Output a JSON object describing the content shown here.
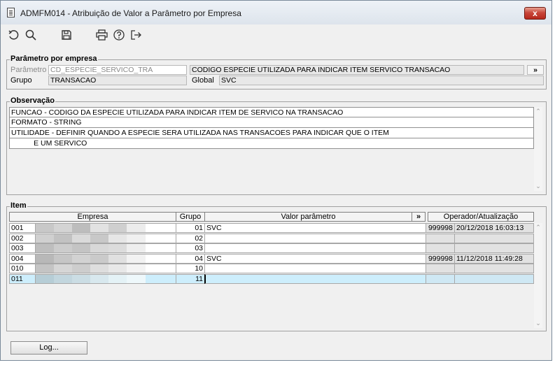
{
  "window": {
    "title": "ADMFM014 - Atribuição de Valor a Parâmetro por Empresa",
    "close_symbol": "x"
  },
  "toolbar": {
    "icons": [
      "undo-icon",
      "search-icon",
      "save-icon",
      "print-icon",
      "help-icon",
      "exit-icon"
    ]
  },
  "param": {
    "section_title": "Parâmetro por empresa",
    "parametro_label": "Parâmetro",
    "parametro_value": "CD_ESPECIE_SERVICO_TRA",
    "descricao_value": "CODIGO ESPECIE UTILIZADA PARA INDICAR ITEM SERVICO TRANSACAO",
    "more_button": "»",
    "grupo_label": "Grupo",
    "grupo_value": "TRANSACAO",
    "global_label": "Global",
    "global_value": "SVC"
  },
  "obs": {
    "section_title": "Observação",
    "lines": [
      "FUNCAO - CODIGO DA ESPECIE UTILIZADA PARA INDICAR ITEM DE SERVICO NA TRANSACAO",
      "FORMATO - STRING",
      "UTILIDADE - DEFINIR QUANDO A ESPECIE SERA UTILIZADA NAS TRANSACOES PARA INDICAR QUE O ITEM",
      "           E UM SERVICO"
    ]
  },
  "item": {
    "section_title": "Item",
    "headers": {
      "empresa": "Empresa",
      "grupo": "Grupo",
      "valor": "Valor parâmetro",
      "more": "»",
      "operador": "Operador/Atualização"
    },
    "rows": [
      {
        "code": "001",
        "grupo": "01",
        "valor": "SVC",
        "operador": "999998",
        "data": "20/12/2018 16:03:13"
      },
      {
        "code": "002",
        "grupo": "02",
        "valor": "",
        "operador": "",
        "data": ""
      },
      {
        "code": "003",
        "grupo": "03",
        "valor": "",
        "operador": "",
        "data": ""
      },
      {
        "code": "004",
        "grupo": "04",
        "valor": "SVC",
        "operador": "999998",
        "data": "11/12/2018 11:49:28"
      },
      {
        "code": "010",
        "grupo": "10",
        "valor": "",
        "operador": "",
        "data": ""
      },
      {
        "code": "011",
        "grupo": "11",
        "valor": "",
        "operador": "",
        "data": ""
      }
    ]
  },
  "footer": {
    "log_button": "Log..."
  },
  "colors": {
    "selected_row": "#cdeefc",
    "readonly_field": "#e8e8e8",
    "close_button": "#c8463a"
  }
}
